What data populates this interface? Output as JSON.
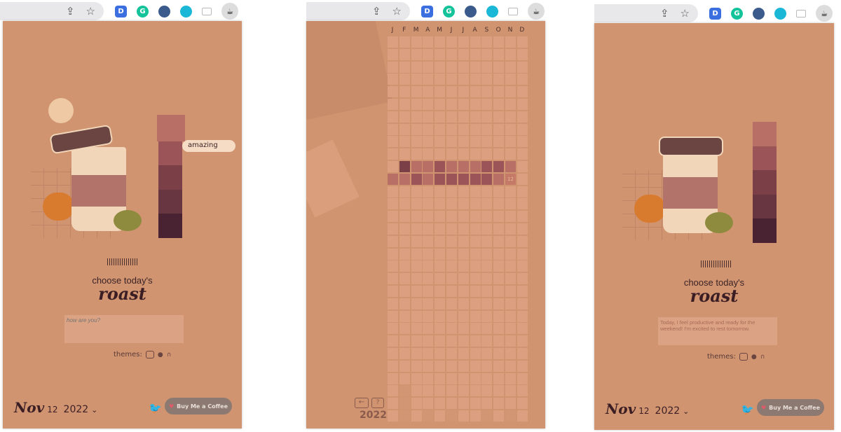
{
  "browser": {
    "icons": [
      "share-icon",
      "star-icon"
    ],
    "extensions": [
      {
        "name": "d-extension",
        "letter": "D",
        "color": "#3b6fe0"
      },
      {
        "name": "grammarly-extension",
        "letter": "G",
        "color": "#15c39a"
      },
      {
        "name": "extension-3",
        "letter": "",
        "color": "#3b5b8c"
      },
      {
        "name": "extension-4",
        "letter": "",
        "color": "#1ab7d6"
      }
    ]
  },
  "colors": {
    "background": "#d09470",
    "text": "#3b1e24",
    "moods": [
      "#b86f65",
      "#9b5458",
      "#7a3f47",
      "#673641",
      "#4a2333"
    ]
  },
  "home": {
    "mood_tooltip": "amazing",
    "title_line1": "choose today's",
    "title_line2": "roast",
    "journal_placeholder": "how are you?",
    "journal_value": "Today, I feel productive and ready for the weekend! I'm excited to rest tomorrow.",
    "themes_label": "themes:",
    "date": {
      "month": "Nov",
      "day": "12",
      "year": "2022"
    },
    "bmc_label": "Buy Me a Coffee"
  },
  "year_view": {
    "months": [
      "J",
      "F",
      "M",
      "A",
      "M",
      "J",
      "J",
      "A",
      "S",
      "O",
      "N",
      "D"
    ],
    "year": "2022",
    "today_label": "12",
    "entries": {
      "11": [
        null,
        2,
        0,
        0,
        1,
        0,
        0,
        0,
        1,
        1,
        0,
        null
      ],
      "12": [
        0,
        0,
        1,
        0,
        1,
        1,
        1,
        1,
        1,
        0,
        null,
        null
      ]
    },
    "days_in_month": [
      31,
      28,
      31,
      30,
      31,
      30,
      31,
      31,
      30,
      31,
      30,
      31
    ]
  }
}
